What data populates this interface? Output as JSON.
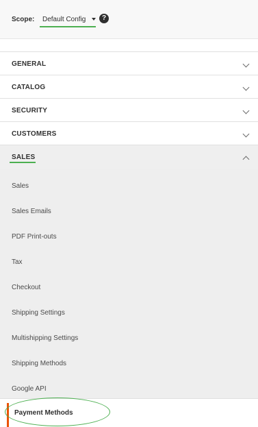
{
  "scope": {
    "label": "Scope:",
    "value": "Default Config",
    "help_glyph": "?"
  },
  "sections": [
    {
      "label": "GENERAL",
      "expanded": false
    },
    {
      "label": "CATALOG",
      "expanded": false
    },
    {
      "label": "SECURITY",
      "expanded": false
    },
    {
      "label": "CUSTOMERS",
      "expanded": false
    },
    {
      "label": "SALES",
      "expanded": true
    }
  ],
  "sales_items": [
    "Sales",
    "Sales Emails",
    "PDF Print-outs",
    "Tax",
    "Checkout",
    "Shipping Settings",
    "Multishipping Settings",
    "Shipping Methods",
    "Google API",
    "Payment Methods"
  ],
  "colors": {
    "annotation_green": "#4caf50",
    "active_accent": "#eb5202",
    "submenu_bg": "#eeeeee"
  },
  "icons": {
    "help": "help-icon",
    "collapsed": "chevron-down-icon",
    "expanded": "chevron-up-icon",
    "dropdown": "caret-down-icon"
  }
}
